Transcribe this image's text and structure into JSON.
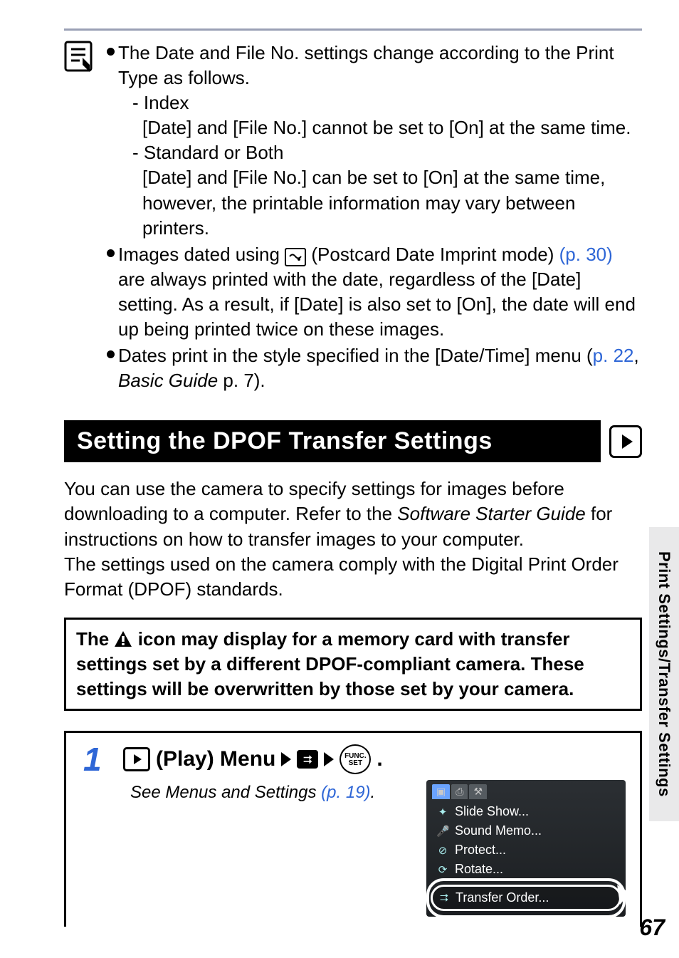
{
  "top": {
    "bullets": [
      {
        "lead": "The Date and File No. settings change according to the Print Type as follows.",
        "subs": [
          {
            "dash": "- Index",
            "text": "[Date] and [File No.] cannot be set to [On] at the same time."
          },
          {
            "dash": "- Standard or Both",
            "text": "[Date] and [File No.] can be set to [On] at the same time, however, the printable information may vary between printers."
          }
        ]
      },
      {
        "before_ref": "Images dated using ",
        "postcard_alt": "postcard-date-imprint-mode-icon",
        "mid": " (Postcard Date Imprint mode) ",
        "ref": "(p. 30)",
        "after_ref": " are always printed with the date, regardless of the [Date] setting. As a result, if [Date] is also set to [On], the date will end up being printed twice on these images."
      },
      {
        "before_ref": "Dates print in the style specified in the [Date/Time] menu (",
        "ref": "p. 22",
        "after_ref_prefix": ", ",
        "emph": "Basic Guide",
        "after_ref_suffix": " p. 7)."
      }
    ]
  },
  "section": {
    "title": "Setting the DPOF Transfer Settings"
  },
  "body": {
    "p1_a": "You can use the camera to specify settings for images before downloading to a computer. Refer to the ",
    "p1_em": "Software Starter Guide",
    "p1_b": " for instructions on how to transfer images to your computer.",
    "p2": "The settings used on the camera comply with the Digital Print Order Format (DPOF) standards."
  },
  "warning": {
    "before_icon": "The ",
    "after_icon": " icon may display for a memory card with transfer settings set by a different DPOF-compliant camera. These settings will be overwritten by those set by your camera."
  },
  "step": {
    "num": "1",
    "play_label": " (Play) Menu",
    "func_top": "FUNC.",
    "func_bottom": "SET",
    "dot": ".",
    "see_prefix": "See Menus and Settings ",
    "see_ref": "(p. 19)",
    "see_suffix": "."
  },
  "screenshot": {
    "tabs": [
      "▣",
      "⎙",
      "⚒"
    ],
    "items": [
      {
        "icon": "✦",
        "label": "Slide Show..."
      },
      {
        "icon": "🎤",
        "label": "Sound Memo..."
      },
      {
        "icon": "⊘",
        "label": "Protect..."
      },
      {
        "icon": "⟳",
        "label": "Rotate..."
      }
    ],
    "highlight": {
      "icon": "⮆",
      "label": "Transfer Order..."
    }
  },
  "side_tab": "Print Settings/Transfer Settings",
  "page_number": "67",
  "chart_data": null
}
